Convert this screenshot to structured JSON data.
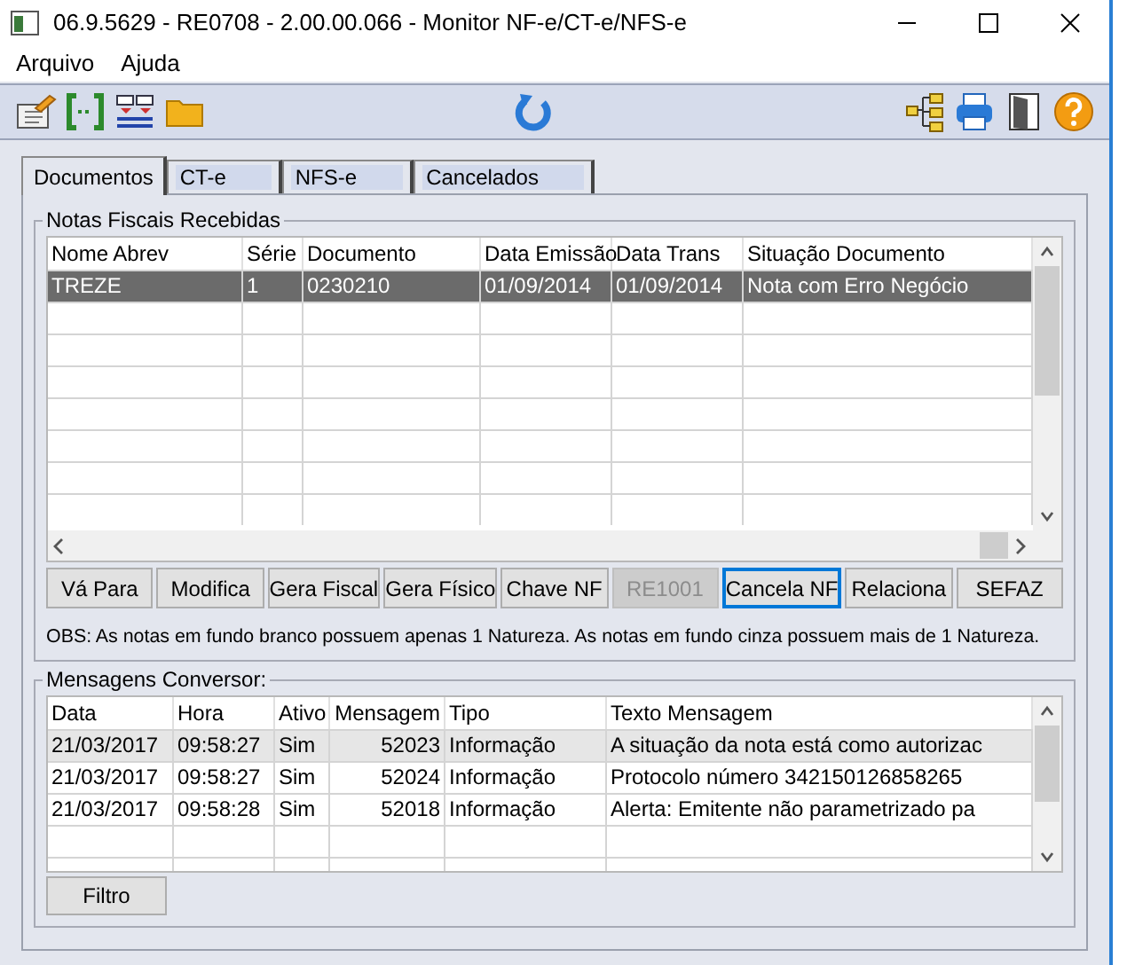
{
  "window": {
    "title": "06.9.5629 - RE0708 - 2.00.00.066 - Monitor NF-e/CT-e/NFS-e"
  },
  "menu": [
    "Arquivo",
    "Ajuda"
  ],
  "tabs": [
    {
      "label": "Documentos",
      "selected": true
    },
    {
      "label": "CT-e",
      "selected": false
    },
    {
      "label": "NFS-e",
      "selected": false
    },
    {
      "label": "Cancelados",
      "selected": false
    }
  ],
  "notas": {
    "title": "Notas Fiscais Recebidas",
    "columns": [
      "Nome Abrev",
      "Série",
      "Documento",
      "Data Emissão",
      "Data Trans",
      "Situação Documento"
    ],
    "rows": [
      {
        "cells": [
          "TREZE",
          "1",
          "0230210",
          "01/09/2014",
          "01/09/2014",
          "Nota com Erro Negócio"
        ],
        "selected": true
      }
    ],
    "buttons": [
      {
        "label": "Vá Para",
        "disabled": false,
        "focused": false
      },
      {
        "label": "Modifica",
        "disabled": false,
        "focused": false
      },
      {
        "label": "Gera Fiscal",
        "disabled": false,
        "focused": false
      },
      {
        "label": "Gera Físico",
        "disabled": false,
        "focused": false
      },
      {
        "label": "Chave NF",
        "disabled": false,
        "focused": false
      },
      {
        "label": "RE1001",
        "disabled": true,
        "focused": false
      },
      {
        "label": "Cancela NF",
        "disabled": false,
        "focused": true
      },
      {
        "label": "Relaciona",
        "disabled": false,
        "focused": false
      },
      {
        "label": "SEFAZ",
        "disabled": false,
        "focused": false
      }
    ],
    "obs": "OBS: As notas em fundo branco possuem apenas 1 Natureza. As notas em fundo cinza possuem mais de 1 Natureza."
  },
  "mensagens": {
    "title": "Mensagens Conversor:",
    "columns": [
      "Data",
      "Hora",
      "Ativo",
      "Mensagem",
      "Tipo",
      "Texto Mensagem"
    ],
    "rows": [
      {
        "cells": [
          "21/03/2017",
          "09:58:27",
          "Sim",
          "52023",
          "Informação",
          "A situação da nota está como autorizac"
        ],
        "selected": true
      },
      {
        "cells": [
          "21/03/2017",
          "09:58:27",
          "Sim",
          "52024",
          "Informação",
          "Protocolo número 342150126858265"
        ],
        "selected": false
      },
      {
        "cells": [
          "21/03/2017",
          "09:58:28",
          "Sim",
          "52018",
          "Informação",
          "Alerta: Emitente não parametrizado pa"
        ],
        "selected": false
      }
    ],
    "button": "Filtro"
  }
}
